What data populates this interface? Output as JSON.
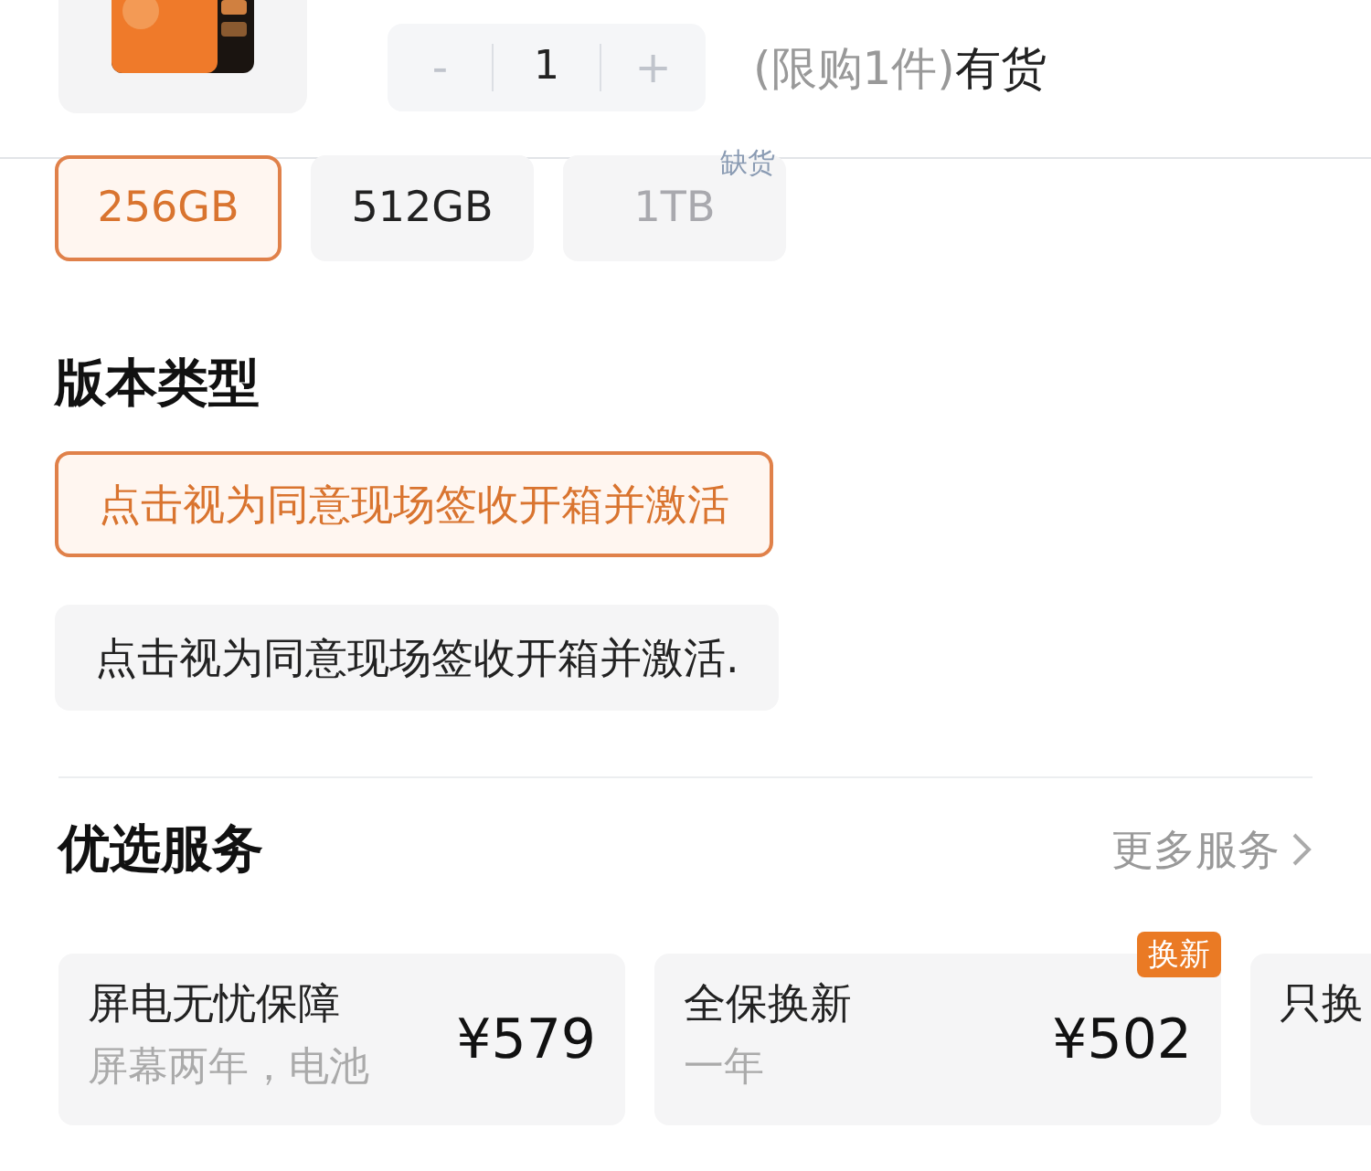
{
  "header": {
    "stepper": {
      "minus": "-",
      "value": "1",
      "plus": "+"
    },
    "limit_note": "(限购1件)",
    "stock": "有货"
  },
  "capacity_options": [
    {
      "label": "256GB",
      "selected": true,
      "disabled": false
    },
    {
      "label": "512GB",
      "selected": false,
      "disabled": false
    },
    {
      "label": "1TB",
      "selected": false,
      "disabled": true,
      "badge": "缺货"
    }
  ],
  "version_section": {
    "title": "版本类型",
    "options": [
      {
        "label": "点击视为同意现场签收开箱并激活",
        "selected": true
      },
      {
        "label": "点击视为同意现场签收开箱并激活.",
        "selected": false
      }
    ]
  },
  "services_section": {
    "title": "优选服务",
    "more_link": "更多服务",
    "cards": [
      {
        "title": "屏电无忧保障",
        "subtitle": "屏幕两年，电池",
        "price": "¥579"
      },
      {
        "title": "全保换新",
        "subtitle": "一年",
        "price": "¥502",
        "badge": "换新"
      },
      {
        "title": "只换"
      }
    ]
  }
}
